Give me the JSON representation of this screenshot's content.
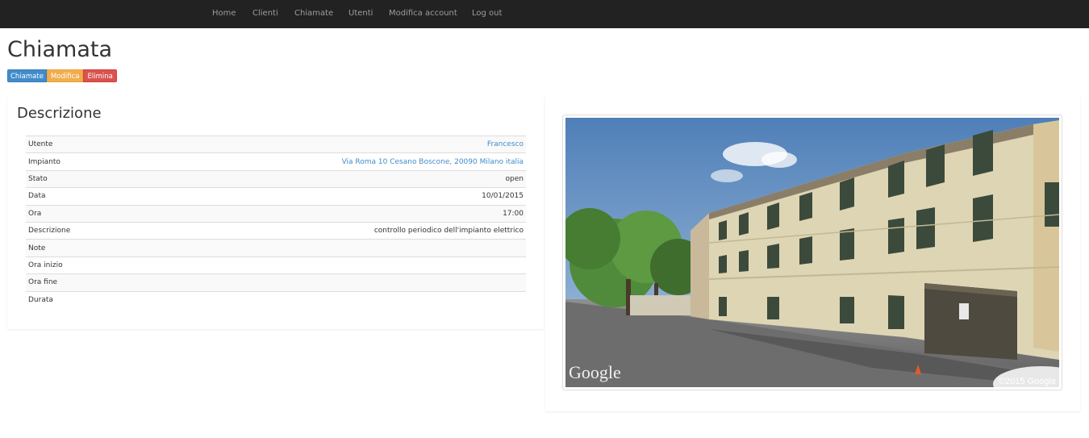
{
  "nav": {
    "items": [
      {
        "label": "Home"
      },
      {
        "label": "Clienti"
      },
      {
        "label": "Chiamate"
      },
      {
        "label": "Utenti"
      },
      {
        "label": "Modifica account"
      },
      {
        "label": "Log out"
      }
    ]
  },
  "page": {
    "title": "Chiamata",
    "buttons": {
      "chiamate": "Chiamate",
      "modifica": "Modifica",
      "elimina": "Elimina"
    }
  },
  "descrizione": {
    "heading": "Descrizione",
    "rows": [
      {
        "label": "Utente",
        "value": "Francesco",
        "link": true
      },
      {
        "label": "Impianto",
        "value": "Via Roma 10 Cesano Boscone, 20090 Milano italia",
        "link": true
      },
      {
        "label": "Stato",
        "value": "open"
      },
      {
        "label": "Data",
        "value": "10/01/2015"
      },
      {
        "label": "Ora",
        "value": "17:00"
      },
      {
        "label": "Descrizione",
        "value": "controllo periodico dell'impianto elettrico"
      },
      {
        "label": "Note",
        "value": ""
      },
      {
        "label": "Ora inizio",
        "value": ""
      },
      {
        "label": "Ora fine",
        "value": ""
      },
      {
        "label": "Durata",
        "value": ""
      }
    ]
  },
  "streetview": {
    "brand": "Google",
    "copyright": "©2015 Google"
  },
  "colors": {
    "navbar": "#222222",
    "link": "#428bca",
    "primary": "#428bca",
    "warning": "#f0ad4e",
    "danger": "#d9534f"
  }
}
